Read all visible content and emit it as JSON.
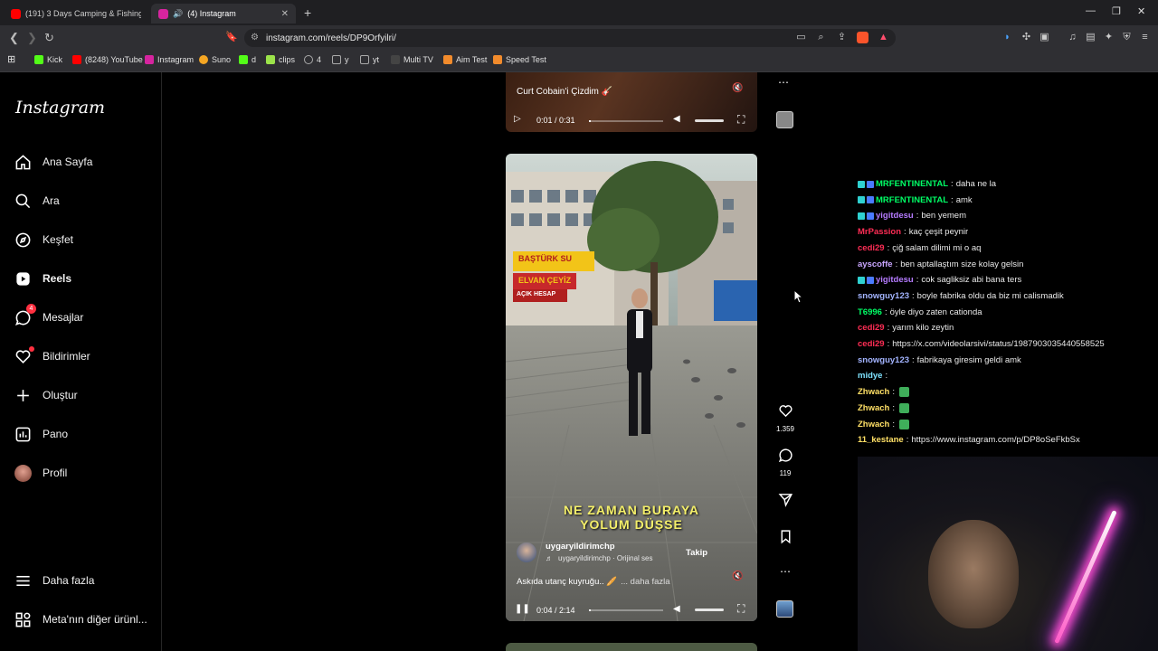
{
  "browser": {
    "tabs": [
      {
        "title": "(191) 3 Days Camping & Fishing Ala...",
        "active": false,
        "favicon_color": "#ff0000"
      },
      {
        "title": "(4) Instagram",
        "active": true,
        "favicon_color": "#d6249f"
      }
    ],
    "new_tab_label": "+",
    "url": "instagram.com/reels/DP9Orfyilri/",
    "bookmarks": [
      {
        "label": "Kick",
        "color": "#53fc18"
      },
      {
        "label": "(8248) YouTube",
        "color": "#ff0000"
      },
      {
        "label": "Instagram",
        "color": "#d6249f"
      },
      {
        "label": "Suno",
        "color": "#f5a623"
      },
      {
        "label": "d",
        "color": "#53fc18"
      },
      {
        "label": "clips",
        "color": "#9be34a"
      },
      {
        "label": "4",
        "color": "#aaaaaa"
      },
      {
        "label": "y",
        "color": "#aaaaaa"
      },
      {
        "label": "yt",
        "color": "#aaaaaa"
      },
      {
        "label": "Multi TV",
        "color": "#444444"
      },
      {
        "label": "Aim Test",
        "color": "#f28b2c"
      },
      {
        "label": "Speed Test",
        "color": "#f28b2c"
      }
    ]
  },
  "instagram": {
    "logo": "Instagram",
    "nav": [
      {
        "label": "Ana Sayfa",
        "icon": "home-icon"
      },
      {
        "label": "Ara",
        "icon": "search-icon"
      },
      {
        "label": "Keşfet",
        "icon": "compass-icon"
      },
      {
        "label": "Reels",
        "icon": "reels-icon",
        "active": true
      },
      {
        "label": "Mesajlar",
        "icon": "messenger-icon",
        "badge": "4"
      },
      {
        "label": "Bildirimler",
        "icon": "heart-icon"
      },
      {
        "label": "Oluştur",
        "icon": "plus-icon"
      },
      {
        "label": "Pano",
        "icon": "dashboard-icon"
      },
      {
        "label": "Profil",
        "icon": "avatar"
      }
    ],
    "more": {
      "label": "Daha fazla",
      "icon": "menu-icon"
    },
    "meta": {
      "label": "Meta'nın diğer ürünl...",
      "icon": "meta-apps-icon"
    }
  },
  "reels": {
    "top": {
      "caption": "Curt Cobain'i Çizdim 🎸",
      "time": "0:01 / 0:31",
      "progress": 0.03
    },
    "main": {
      "overlay_text_line1": "NE ZAMAN BURAYA",
      "overlay_text_line2": "YOLUM DÜŞSE",
      "username": "uygaryildirimchp",
      "audio": "uygaryildirimchp · Orijinal ses",
      "follow_label": "Takip",
      "caption": "Askıda utanç kuyruğu.. 🥖",
      "more_label": "... daha fazla",
      "time": "0:04 / 2:14",
      "progress": 0.03,
      "sign_text1": "BAŞTÜRK SU",
      "sign_text2": "ELVAN ÇEYİZ",
      "sign_text3": "AÇIK HESAP",
      "likes": "1.359",
      "comments": "119"
    }
  },
  "chat": [
    {
      "user": "MRFENTINENTAL",
      "color": "#00ff66",
      "text": "daha ne la",
      "badges": true
    },
    {
      "user": "MRFENTINENTAL",
      "color": "#00ff66",
      "text": "amk",
      "badges": true
    },
    {
      "user": "yigitdesu",
      "color": "#b57bff",
      "text": "ben yemem",
      "badges": true
    },
    {
      "user": "MrPassion",
      "color": "#ff2d55",
      "text": "kaç çeşit peynir",
      "badges": false
    },
    {
      "user": "cedi29",
      "color": "#ff2d55",
      "text": "çiğ salam dilimi mi o aq",
      "badges": false
    },
    {
      "user": "ayscoffe",
      "color": "#c9a6ff",
      "text": "ben aptallaştım size kolay gelsin",
      "badges": false
    },
    {
      "user": "yigitdesu",
      "color": "#b57bff",
      "text": "cok sagliksiz abi bana ters",
      "badges": true
    },
    {
      "user": "snowguy123",
      "color": "#a3b4ff",
      "text": "boyle fabrika oldu da biz mi calismadik",
      "badges": false
    },
    {
      "user": "T6996",
      "color": "#00ff66",
      "text": "öyle diyo zaten cationda",
      "badges": false
    },
    {
      "user": "cedi29",
      "color": "#ff2d55",
      "text": "yarım kilo zeytin",
      "badges": false
    },
    {
      "user": "cedi29",
      "color": "#ff2d55",
      "text": "https://x.com/videolarsivi/status/1987903035440558525",
      "badges": false
    },
    {
      "user": "snowguy123",
      "color": "#a3b4ff",
      "text": "fabrikaya giresim geldi amk",
      "badges": false
    },
    {
      "user": "midye",
      "color": "#7fe3ff",
      "text": "",
      "badges": false
    },
    {
      "user": "Zhwach",
      "color": "#ffe066",
      "text": "",
      "badges": false,
      "emote": true
    },
    {
      "user": "Zhwach",
      "color": "#ffe066",
      "text": "",
      "badges": false,
      "emote": true
    },
    {
      "user": "Zhwach",
      "color": "#ffe066",
      "text": "",
      "badges": false,
      "emote": true
    },
    {
      "user": "11_kestane",
      "color": "#ffe066",
      "text": "https://www.instagram.com/p/DP8oSeFkbSx",
      "badges": false
    }
  ]
}
